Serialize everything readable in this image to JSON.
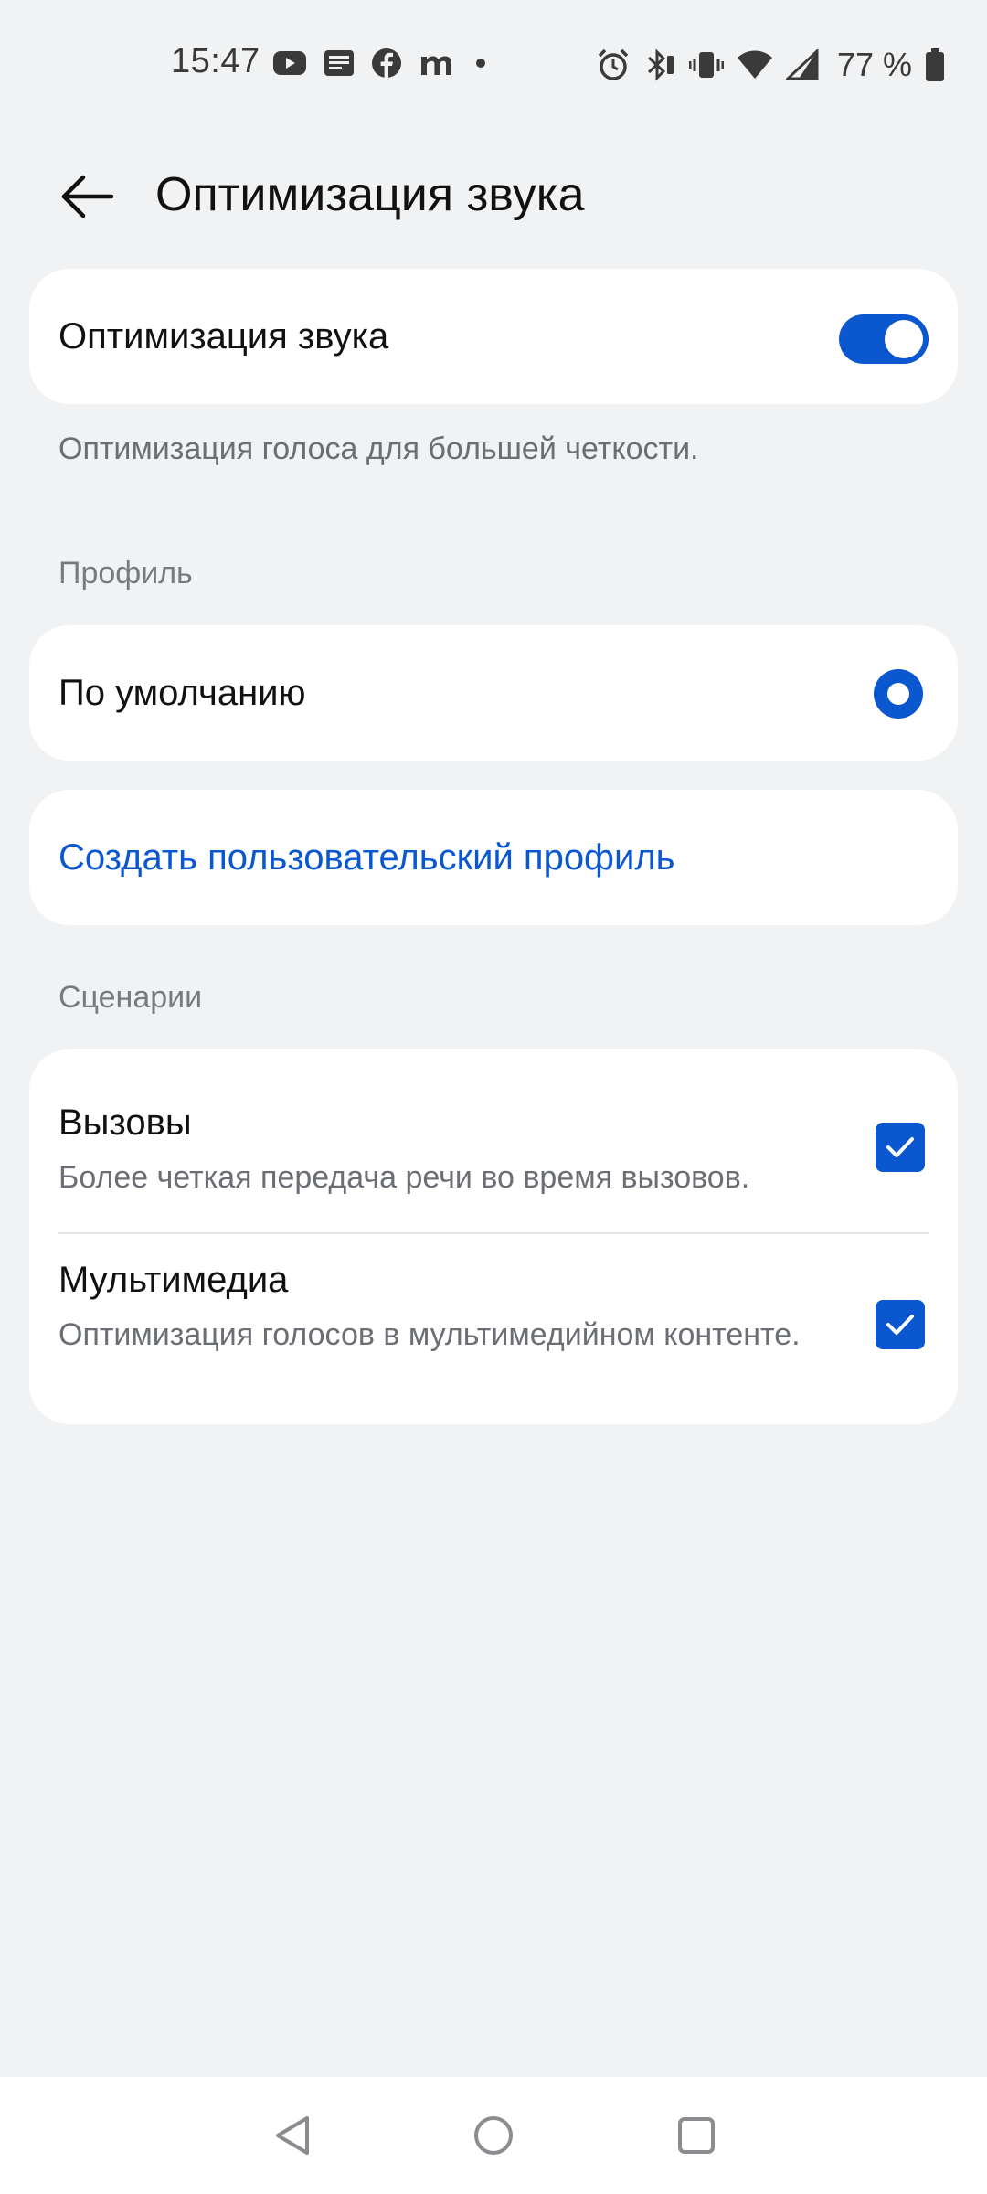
{
  "status_bar": {
    "time": "15:47",
    "battery_text": "77 %",
    "left_icons": [
      "youtube-icon",
      "news-icon",
      "facebook-icon",
      "m-icon",
      "dot-icon"
    ],
    "right_icons": [
      "alarm-icon",
      "bluetooth-icon",
      "vibrate-icon",
      "wifi-icon",
      "signal-icon",
      "battery-icon"
    ]
  },
  "header": {
    "title": "Оптимизация звука",
    "back_icon": "arrow-left-icon"
  },
  "optimization": {
    "label": "Оптимизация звука",
    "enabled": true,
    "description": "Оптимизация голоса для большей четкости."
  },
  "profile": {
    "section_label": "Профиль",
    "default_label": "По умолчанию",
    "default_selected": true,
    "create_label": "Создать пользовательский профиль"
  },
  "scenarios": {
    "section_label": "Сценарии",
    "items": [
      {
        "title": "Вызовы",
        "description": "Более четкая передача речи во время вызовов.",
        "checked": true
      },
      {
        "title": "Мультимедиа",
        "description": "Оптимизация голосов в мультимедийном контенте.",
        "checked": true
      }
    ]
  },
  "nav_bar": {
    "icons": [
      "back-triangle-icon",
      "home-circle-icon",
      "recents-square-icon"
    ]
  },
  "colors": {
    "accent": "#0b57d0",
    "background": "#f1f2f4",
    "card": "#ffffff",
    "secondary_text": "#6b6e74"
  }
}
